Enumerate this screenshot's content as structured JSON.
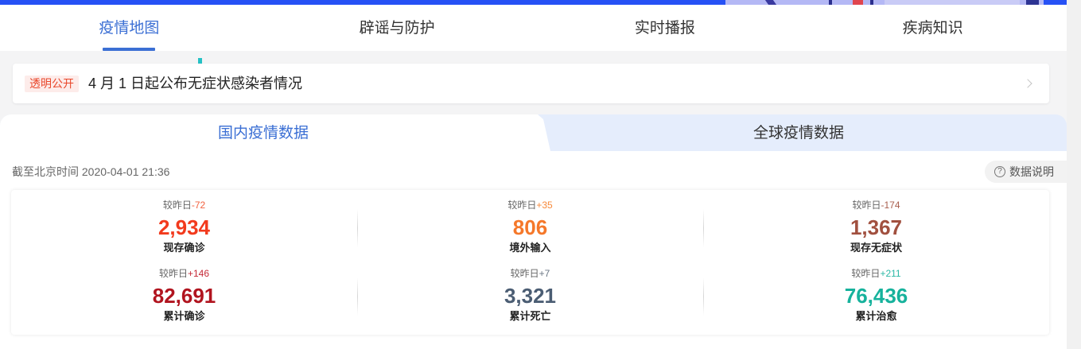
{
  "colors": {
    "banner": "#2651f5",
    "accent": "#3b6fd4",
    "badge_text": "#e9472b",
    "badge_bg": "#fdecea",
    "tab_inactive_bg": "#e5edfc"
  },
  "nav": {
    "tabs": [
      {
        "label": "疫情地图",
        "active": true
      },
      {
        "label": "辟谣与防护",
        "active": false
      },
      {
        "label": "实时播报",
        "active": false
      },
      {
        "label": "疾病知识",
        "active": false
      }
    ]
  },
  "notice": {
    "badge": "透明公开",
    "text": "4 月 1 日起公布无症状感染者情况",
    "icon": "chevron-right-icon"
  },
  "data_tabs": [
    {
      "label": "国内疫情数据",
      "active": true
    },
    {
      "label": "全球疫情数据",
      "active": false
    }
  ],
  "update_time": "截至北京时间 2020-04-01 21:36",
  "data_note": {
    "label": "数据说明",
    "icon": "question-circle-icon"
  },
  "compare_label": "较昨日",
  "stats": [
    {
      "delta": "-72",
      "value": "2,934",
      "label": "现存确诊",
      "color": "#f23a1d",
      "delta_color": "#f2613f"
    },
    {
      "delta": "+35",
      "value": "806",
      "label": "境外输入",
      "color": "#f5782a",
      "delta_color": "#f7893a"
    },
    {
      "delta": "-174",
      "value": "1,367",
      "label": "现存无症状",
      "color": "#a1503f",
      "delta_color": "#a9604f"
    },
    {
      "delta": "+146",
      "value": "82,691",
      "label": "累计确诊",
      "color": "#b1141f",
      "delta_color": "#c52a37"
    },
    {
      "delta": "+7",
      "value": "3,321",
      "label": "累计死亡",
      "color": "#4b5d73",
      "delta_color": "#6b7785"
    },
    {
      "delta": "+211",
      "value": "76,436",
      "label": "累计治愈",
      "color": "#16b29c",
      "delta_color": "#2bb8a6"
    }
  ]
}
